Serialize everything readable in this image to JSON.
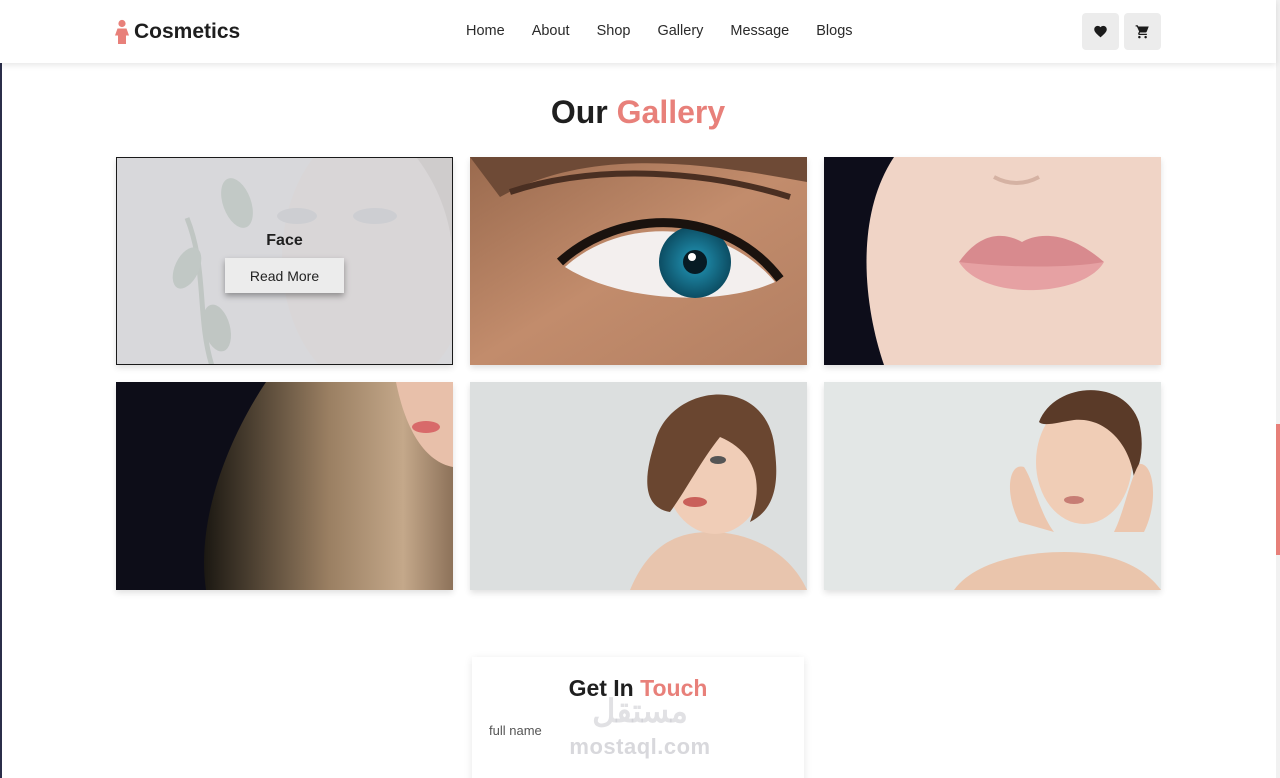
{
  "header": {
    "brand_name": "Cosmetics",
    "nav": [
      "Home",
      "About",
      "Shop",
      "Gallery",
      "Message",
      "Blogs"
    ],
    "icons": [
      "heart-icon",
      "cart-icon"
    ]
  },
  "gallery": {
    "title_main": "Our",
    "title_accent": "Gallery",
    "tiles": [
      {
        "caption": "Face",
        "button": "Read More"
      }
    ]
  },
  "contact": {
    "title_main": "Get In",
    "title_accent": "Touch",
    "field_label": "full name"
  },
  "watermark": {
    "arabic": "مستقل",
    "latin": "mostaql.com"
  },
  "colors": {
    "accent": "#e8807a",
    "dark": "#1f1f1f"
  }
}
